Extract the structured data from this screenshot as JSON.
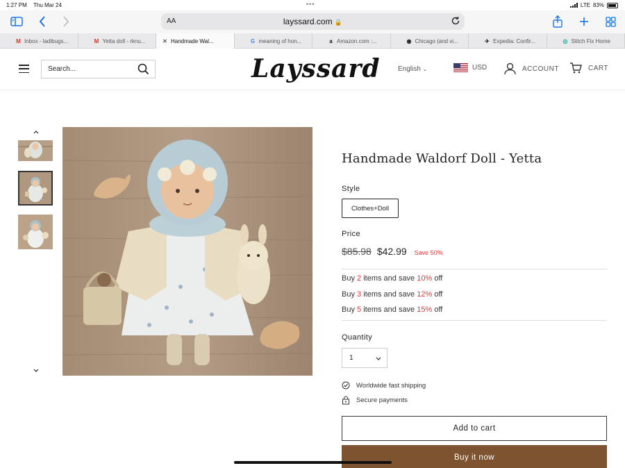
{
  "status_bar": {
    "time": "1:27 PM",
    "date": "Thu Mar 24",
    "dots": "•••",
    "network": "LTE",
    "battery": "83%"
  },
  "browser": {
    "aa_label": "AA",
    "url": "layssard.com",
    "tabs": [
      {
        "label": "Inbox - ladibugs...",
        "icon": "gmail-icon",
        "glyph": "M",
        "color": "#d93025"
      },
      {
        "label": "Yetta doll - rknu...",
        "icon": "gmail-icon",
        "glyph": "M",
        "color": "#d93025"
      },
      {
        "label": "Handmade Wal...",
        "icon": "close-icon",
        "glyph": "✕",
        "color": "#555555"
      },
      {
        "label": "meaning of hon...",
        "icon": "google-icon",
        "glyph": "G",
        "color": "#4285f4"
      },
      {
        "label": "Amazon.com :...",
        "icon": "amazon-icon",
        "glyph": "a",
        "color": "#111111"
      },
      {
        "label": "Chicago (and vi...",
        "icon": "site-icon",
        "glyph": "◉",
        "color": "#222222"
      },
      {
        "label": "Expedia: Confir...",
        "icon": "expedia-icon",
        "glyph": "✈",
        "color": "#222222"
      },
      {
        "label": "Stitch Fix Home",
        "icon": "stitchfix-icon",
        "glyph": "◎",
        "color": "#1aa89b"
      }
    ],
    "active_tab_index": 2
  },
  "header": {
    "search_placeholder": "Search...",
    "logo": "Layssard",
    "language": "English",
    "currency": "USD",
    "account": "ACCOUNT",
    "cart": "CART"
  },
  "product": {
    "title": "Handmade Waldorf Doll - Yetta",
    "style_label": "Style",
    "style_option": "Clothes+Doll",
    "price_label": "Price",
    "old_price": "$85.98",
    "new_price": "$42.99",
    "save_text": "Save 50%",
    "bulk_offers": [
      {
        "pre": "Buy ",
        "qty": "2",
        "mid": " items and save ",
        "pct": "10%",
        "post": " off"
      },
      {
        "pre": "Buy ",
        "qty": "3",
        "mid": " items and save ",
        "pct": "12%",
        "post": " off"
      },
      {
        "pre": "Buy ",
        "qty": "5",
        "mid": " items and save ",
        "pct": "15%",
        "post": " off"
      }
    ],
    "quantity_label": "Quantity",
    "quantity_value": "1",
    "features": [
      "Worldwide fast shipping",
      "Secure payments"
    ],
    "add_to_cart": "Add to cart",
    "buy_now": "Buy it now"
  },
  "colors": {
    "accent_red": "#e33333",
    "buy_button": "#7d5330",
    "browser_blue": "#1a73e8"
  }
}
